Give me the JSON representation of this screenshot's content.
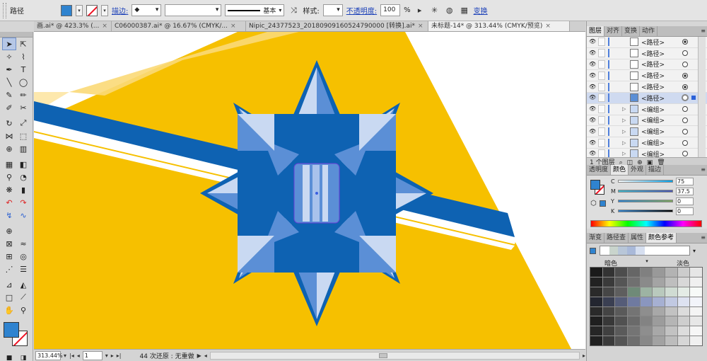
{
  "control_bar": {
    "object_type": "路径",
    "stroke_label": "描边:",
    "stroke_style": "基本",
    "style_label": "样式:",
    "opacity_label": "不透明度:",
    "opacity_value": "100",
    "opacity_unit": "%",
    "transform_label": "变换",
    "fill_color": "#2f83cf"
  },
  "doc_tabs": [
    {
      "label": "画.ai* @ 423.3% (..."
    },
    {
      "label": "C06000387.ai* @ 16.67% (CMYK/..."
    },
    {
      "label": "Nipic_24377523_20180909160524790000 [转换].ai*"
    },
    {
      "label": "未标题-14* @ 313.44% (CMYK/预览)"
    }
  ],
  "status_bar": {
    "zoom": "313.44%",
    "artboard": "1",
    "status_text": "44 次还原 : 无重做"
  },
  "layers_panel": {
    "tabs": [
      "图层",
      "对齐",
      "变换",
      "动作"
    ],
    "rows": [
      {
        "name": "<路径>",
        "target": "filled"
      },
      {
        "name": "<路径>",
        "target": "empty"
      },
      {
        "name": "<路径>",
        "target": "empty"
      },
      {
        "name": "<路径>",
        "target": "filled"
      },
      {
        "name": "<路径>",
        "target": "filled"
      },
      {
        "name": "<路径>",
        "target": "selected"
      },
      {
        "name": "<编组>",
        "target": "empty"
      },
      {
        "name": "<编组>",
        "target": "empty"
      },
      {
        "name": "<编组>",
        "target": "empty"
      },
      {
        "name": "<编组>",
        "target": "empty"
      },
      {
        "name": "<编组>",
        "target": "empty"
      }
    ],
    "footer": "1 个图层"
  },
  "color_panel": {
    "tabs": [
      "透明度",
      "颜色",
      "外观",
      "描边"
    ],
    "channels": [
      {
        "label": "C",
        "value": "75",
        "gradient": "linear-gradient(90deg,#fff,#00a0e9)"
      },
      {
        "label": "M",
        "value": "37.5",
        "gradient": "linear-gradient(90deg,#3fb5c8,#4a55b0)"
      },
      {
        "label": "Y",
        "value": "0",
        "gradient": "linear-gradient(90deg,#2f83cf,#7ea75c)"
      },
      {
        "label": "K",
        "value": "0",
        "gradient": "linear-gradient(90deg,#2f83cf,#000)"
      }
    ]
  },
  "guide_panel": {
    "tabs": [
      "渐变",
      "路径查",
      "属性",
      "颜色参考"
    ],
    "dark_label": "暗色",
    "light_label": "淡色",
    "harmony": [
      "#ffffff",
      "#c9d4cc",
      "#b8c6d8",
      "#a9b9d9",
      "#d6dff0",
      "#ffffff",
      "#ffffff",
      "#ffffff",
      "#ffffff",
      "#ffffff"
    ]
  },
  "colors": {
    "yellow": "#f6c000",
    "blue": "#0e62b2",
    "light_blue": "#5b8fd6",
    "pale_blue": "#c9d9f2"
  }
}
